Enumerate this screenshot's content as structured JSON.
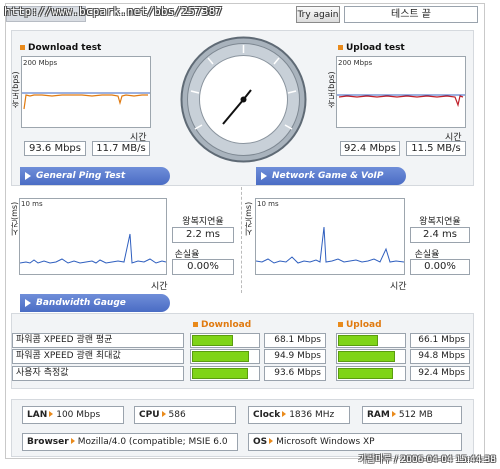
{
  "header": {
    "url": "http://www.bcpark.net/bbs/257387",
    "try_again": "Try again",
    "result": "테스트 끝"
  },
  "download": {
    "title": "Download test",
    "ylabel": "속도(bps)",
    "scale": "200 Mbps",
    "time": "시간",
    "mbps": "93.6 Mbps",
    "mbs": "11.7 MB/s"
  },
  "upload": {
    "title": "Upload test",
    "ylabel": "속도(bps)",
    "scale": "200 Mbps",
    "time": "시간",
    "mbps": "92.4 Mbps",
    "mbs": "11.5 MB/s"
  },
  "speedometer": {
    "ticks": [
      "0",
      "100K",
      "500K",
      "1M",
      "2M",
      "5M",
      "10M",
      "20M",
      "50M",
      "100M"
    ]
  },
  "tabs": {
    "ping": "General Ping Test",
    "game": "Network Game & VoIP Test",
    "bandwidth": "Bandwidth Gauge"
  },
  "ping_left": {
    "ylabel": "시간(ms)",
    "scale": "10 ms",
    "time": "시간",
    "rtt_label": "왕복지연율",
    "rtt": "2.2 ms",
    "loss_label": "손실율",
    "loss": "0.00%"
  },
  "ping_right": {
    "ylabel": "시간(ms)",
    "scale": "10 ms",
    "time": "시간",
    "rtt_label": "왕복지연율",
    "rtt": "2.4 ms",
    "loss_label": "손실율",
    "loss": "0.00%"
  },
  "gauge": {
    "download_title": "Download",
    "upload_title": "Upload",
    "rows": [
      {
        "label": "파워콤 XPEED 광랜 평균",
        "down": "68.1 Mbps",
        "down_frac": 0.62,
        "up": "66.1 Mbps",
        "up_frac": 0.61
      },
      {
        "label": "파워콤 XPEED 광랜 최대값",
        "down": "94.9 Mbps",
        "down_frac": 0.86,
        "up": "94.8 Mbps",
        "up_frac": 0.86
      },
      {
        "label": "사용자 측정값",
        "down": "93.6 Mbps",
        "down_frac": 0.85,
        "up": "92.4 Mbps",
        "up_frac": 0.84
      }
    ]
  },
  "system": {
    "lan_label": "LAN",
    "lan": "100 Mbps",
    "cpu_label": "CPU",
    "cpu": "586",
    "clock_label": "Clock",
    "clock": "1836 MHz",
    "ram_label": "RAM",
    "ram": "512 MB",
    "browser_label": "Browser",
    "browser": "Mozilla/4.0 (compatible; MSIE 6.0",
    "os_label": "OS",
    "os": "Microsoft Windows XP"
  },
  "watermark": "가람마루 / 2006-04-04 15:44:38",
  "colors": {
    "accent": "#e98a1b",
    "bar": "#7fd417",
    "tab": "#4a6cc4",
    "line_download": "#e07a10",
    "line_upload": "#c0202a",
    "line_blue": "#2f5fbf"
  }
}
